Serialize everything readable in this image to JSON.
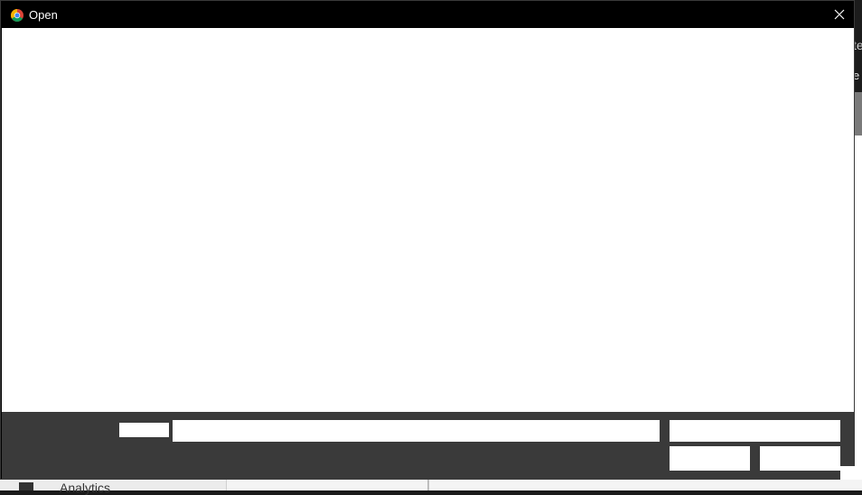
{
  "background_app": {
    "edge_text_1": "te",
    "edge_text_2": "e",
    "sidebar_item_label": "Analytics"
  },
  "dialog": {
    "title": "Open",
    "app_icon": "chrome-icon",
    "close_icon": "close-icon",
    "file_name_label": "",
    "file_name_value": "",
    "file_type_value": "",
    "open_button_label": "",
    "cancel_button_label": ""
  },
  "colors": {
    "titlebar": "#000000",
    "footer": "#3a3a3a",
    "content": "#ffffff"
  }
}
